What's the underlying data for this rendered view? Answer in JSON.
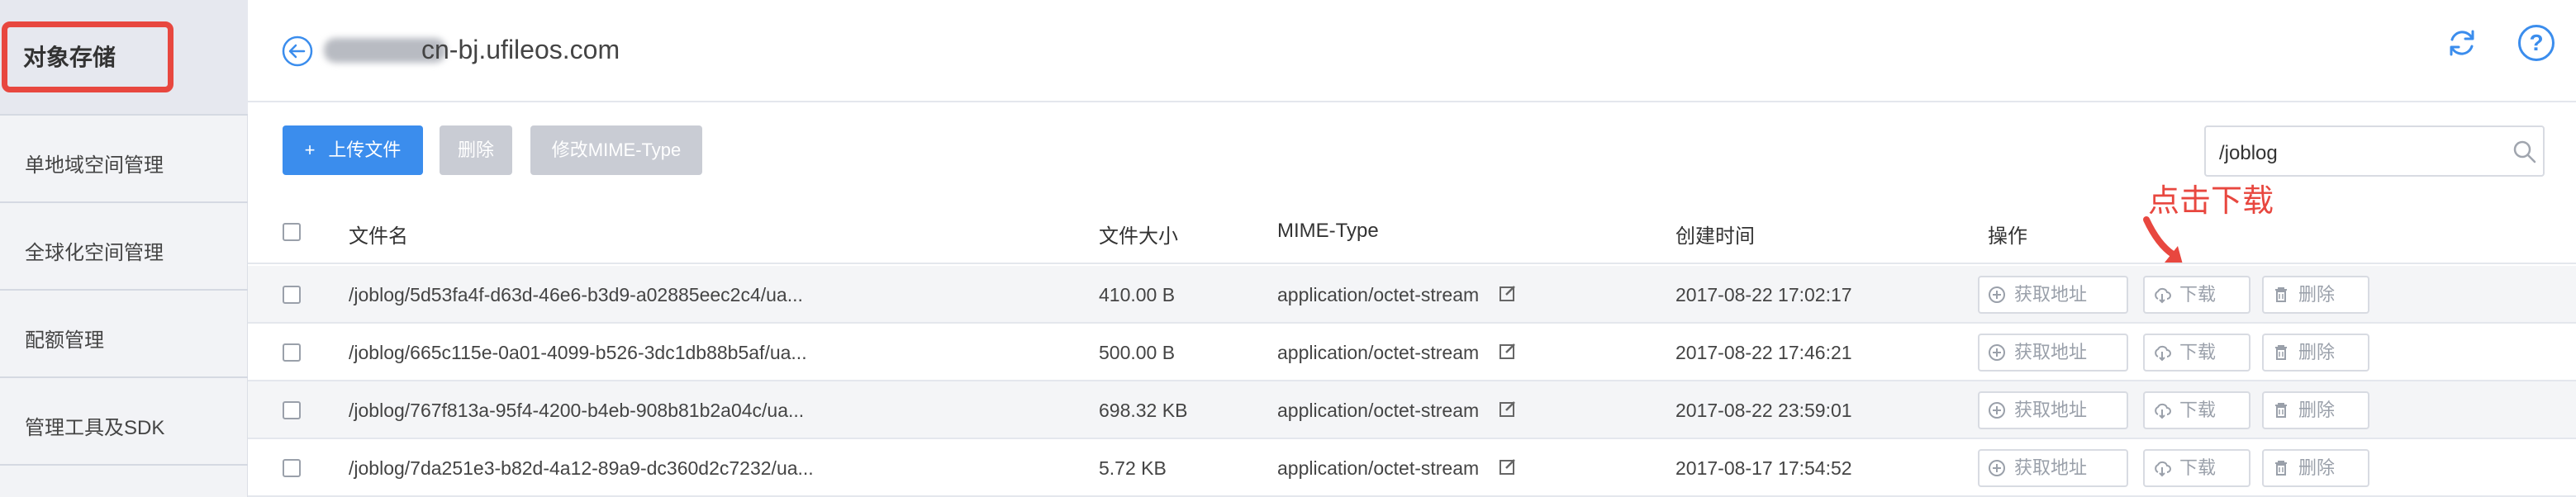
{
  "sidebar": {
    "title": "对象存储",
    "items": [
      {
        "label": "单地域空间管理"
      },
      {
        "label": "全球化空间管理"
      },
      {
        "label": "配额管理"
      },
      {
        "label": "管理工具及SDK"
      }
    ]
  },
  "header": {
    "host": "cn-bj.ufileos.com"
  },
  "toolbar": {
    "upload_label": "上传文件",
    "upload_icon": "+",
    "delete_label": "删除",
    "mime_label": "修改MIME-Type"
  },
  "search": {
    "value": "/joblog"
  },
  "annotation": {
    "text": "点击下载"
  },
  "table": {
    "columns": {
      "name": "文件名",
      "size": "文件大小",
      "mime": "MIME-Type",
      "created": "创建时间",
      "ops": "操作"
    },
    "rows": [
      {
        "name": "/joblog/5d53fa4f-d63d-46e6-b3d9-a02885eec2c4/ua...",
        "size": "410.00 B",
        "mime": "application/octet-stream",
        "created": "2017-08-22 17:02:17"
      },
      {
        "name": "/joblog/665c115e-0a01-4099-b526-3dc1db88b5af/ua...",
        "size": "500.00 B",
        "mime": "application/octet-stream",
        "created": "2017-08-22 17:46:21"
      },
      {
        "name": "/joblog/767f813a-95f4-4200-b4eb-908b81b2a04c/ua...",
        "size": "698.32 KB",
        "mime": "application/octet-stream",
        "created": "2017-08-22 23:59:01"
      },
      {
        "name": "/joblog/7da251e3-b82d-4a12-89a9-dc360d2c7232/ua...",
        "size": "5.72 KB",
        "mime": "application/octet-stream",
        "created": "2017-08-17 17:54:52"
      }
    ],
    "ops": {
      "get_url": "获取地址",
      "download": "下载",
      "delete": "删除"
    }
  },
  "colors": {
    "accent": "#3b8ded",
    "annotation": "#e8473f",
    "disabled": "#c9ccd4"
  }
}
